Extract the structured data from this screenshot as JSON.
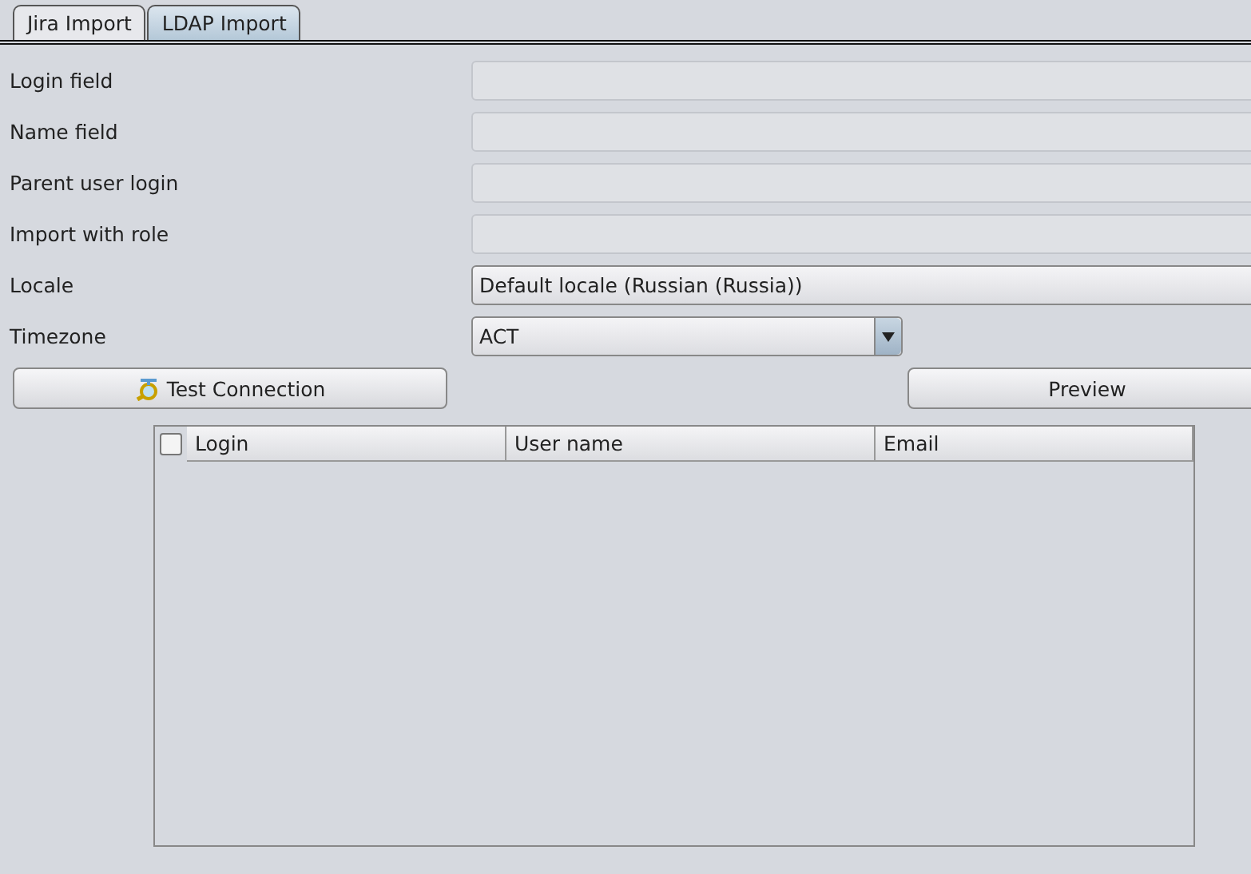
{
  "tabs": [
    {
      "label": "Jira Import",
      "selected": false
    },
    {
      "label": "LDAP Import",
      "selected": true
    }
  ],
  "fields": [
    {
      "label": "Login field",
      "kind": "text",
      "disabled": true
    },
    {
      "label": "Name field",
      "kind": "text",
      "disabled": true
    },
    {
      "label": "Parent user login",
      "kind": "text",
      "disabled": true
    },
    {
      "label": "Import with role",
      "kind": "text",
      "disabled": true
    },
    {
      "label": "Locale",
      "kind": "select",
      "value": "Default locale (Russian (Russia))"
    },
    {
      "label": "Timezone",
      "kind": "combo",
      "value": "ACT"
    }
  ],
  "buttons": [
    {
      "label": "Test Connection",
      "kind": "test"
    },
    {
      "label": "Preview",
      "kind": "plain"
    }
  ],
  "table": {
    "select_all_checked": false,
    "columns": [
      "Login",
      "User name",
      "Email"
    ]
  }
}
